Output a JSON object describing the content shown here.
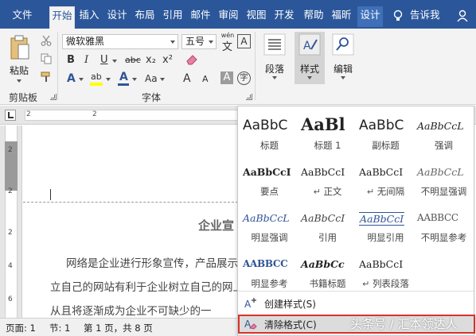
{
  "tabs": [
    "文件",
    "开始",
    "插入",
    "设计",
    "布局",
    "引用",
    "邮件",
    "审阅",
    "视图",
    "开发",
    "帮助",
    "福昕",
    "设计"
  ],
  "tell_me": "告诉我",
  "ribbon": {
    "clipboard": {
      "paste_label": "粘贴",
      "group_label": "剪贴板"
    },
    "font": {
      "name": "微软雅黑",
      "size": "五号",
      "wen_label": "wén",
      "wen_char": "文",
      "A_box": "A",
      "bold": "B",
      "italic": "I",
      "underline": "U",
      "strike": "abc",
      "subscript": "x₂",
      "superscript": "x²",
      "text_effect": "A",
      "highlight": "ab",
      "font_color": "A",
      "case": "Aa",
      "grow": "A",
      "shrink": "A",
      "char_shade": "A",
      "enclose": "字",
      "group_label": "字体"
    },
    "paragraph_label": "段落",
    "styles_label": "样式",
    "editing_label": "编辑"
  },
  "ruler": {
    "h_nums": [
      "2",
      "2"
    ],
    "v_nums": [
      "2",
      "2",
      "2",
      "4",
      "6"
    ]
  },
  "document": {
    "title": "企业宣",
    "line1": "网络是企业进行形象宣传，产品展示",
    "line2": "立自己的网站有利于企业树立自己的网上",
    "line3": "从且将逐渐成为企业不可缺少的一"
  },
  "status": {
    "page": "页面: 1",
    "section": "节: 1",
    "pages": "第 1 页，共 8 页"
  },
  "gallery": {
    "styles": [
      {
        "sample": "AaBbC",
        "name": "标题"
      },
      {
        "sample": "AaBl",
        "name": "标题 1"
      },
      {
        "sample": "AaBbC",
        "name": "副标题"
      },
      {
        "sample": "AaBbCcL",
        "name": "强调"
      },
      {
        "sample": "AaBbCcI",
        "name": "要点"
      },
      {
        "sample": "AaBbCcI",
        "name": "正文",
        "mark": "↵"
      },
      {
        "sample": "AaBbCcI",
        "name": "无间隔",
        "mark": "↵"
      },
      {
        "sample": "AaBbCcL",
        "name": "不明显强调"
      },
      {
        "sample": "AaBbCcL",
        "name": "明显强调"
      },
      {
        "sample": "AaBbCcI",
        "name": "引用"
      },
      {
        "sample": "AaBbCcI",
        "name": "明显引用"
      },
      {
        "sample": "AABBCC",
        "name": "不明显参考"
      },
      {
        "sample": "AABBCC",
        "name": "明显参考"
      },
      {
        "sample": "AaBbCc",
        "name": "书籍标题"
      },
      {
        "sample": "AaBbCcI",
        "name": "列表段落",
        "mark": "↵"
      }
    ],
    "create_style": "创建样式(S)",
    "clear_format": "清除格式(C)"
  },
  "watermark": "头条号 / 汇本领达人",
  "colors": {
    "tab_bar": "#2b579a",
    "highlight_border": "#d9312b",
    "accent_blue": "#2f5597"
  }
}
